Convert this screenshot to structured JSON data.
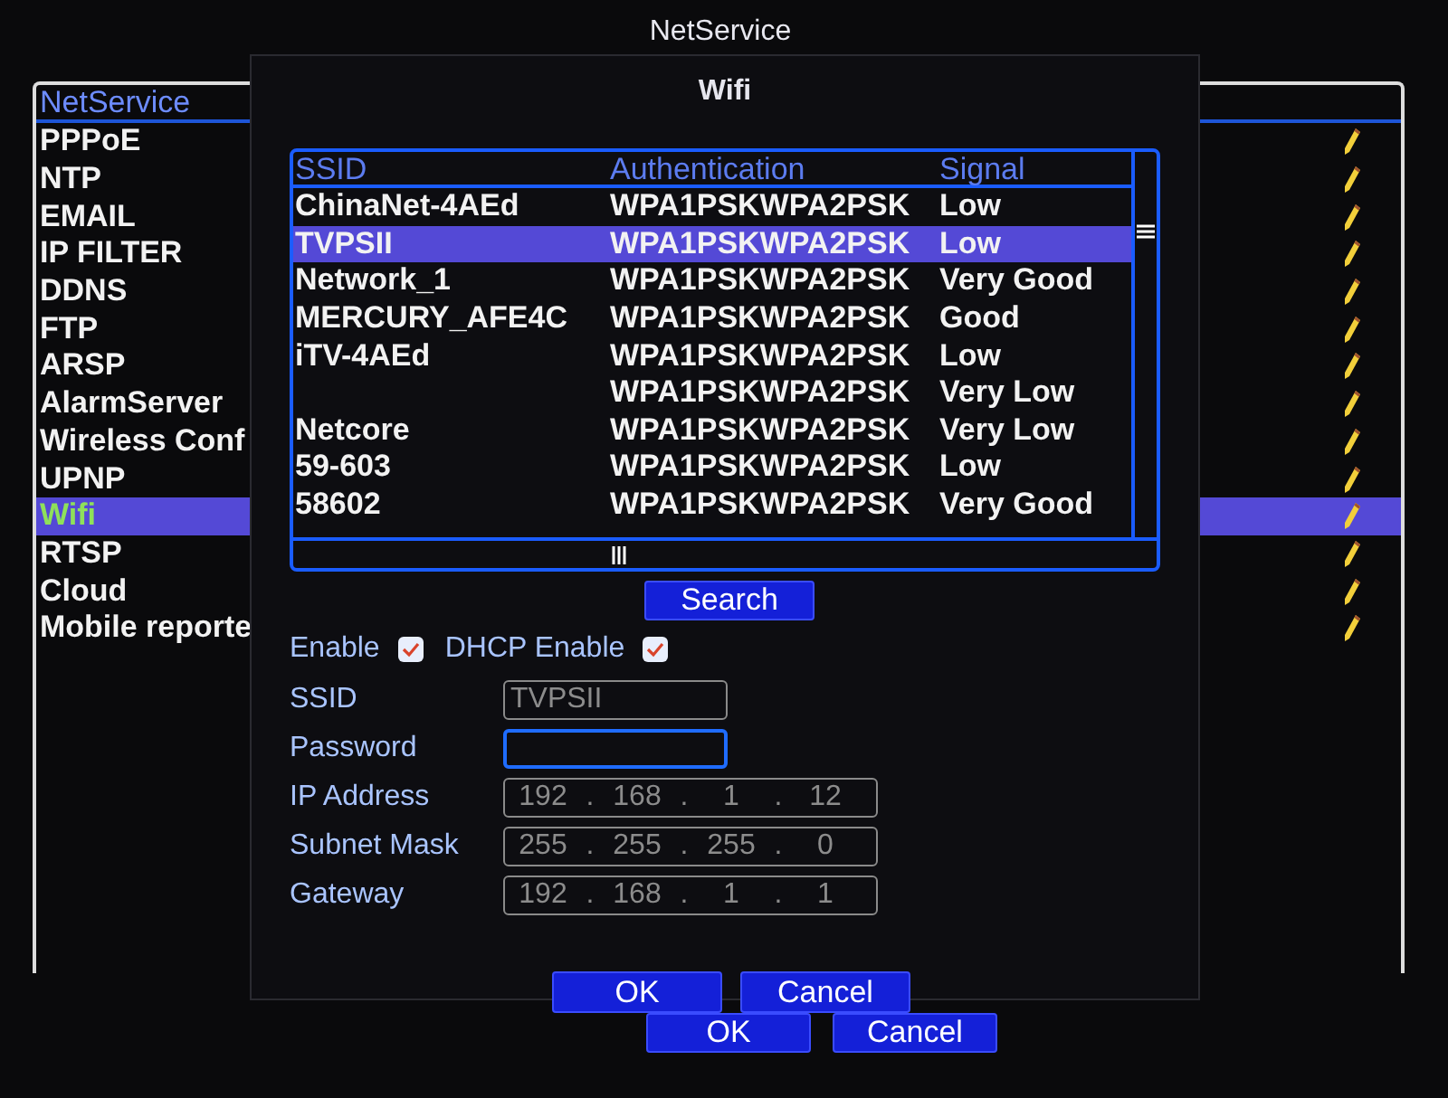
{
  "window": {
    "title": "NetService"
  },
  "service_list": {
    "header": "NetService",
    "items": [
      {
        "label": "PPPoE",
        "selected": false
      },
      {
        "label": "NTP",
        "selected": false
      },
      {
        "label": "EMAIL",
        "selected": false
      },
      {
        "label": "IP FILTER",
        "selected": false
      },
      {
        "label": "DDNS",
        "selected": false
      },
      {
        "label": "FTP",
        "selected": false
      },
      {
        "label": "ARSP",
        "selected": false
      },
      {
        "label": "AlarmServer",
        "selected": false
      },
      {
        "label": "Wireless Conf",
        "selected": false
      },
      {
        "label": "UPNP",
        "selected": false
      },
      {
        "label": "Wifi",
        "selected": true
      },
      {
        "label": "RTSP",
        "selected": false
      },
      {
        "label": "Cloud",
        "selected": false
      },
      {
        "label": "Mobile reporte",
        "selected": false
      }
    ]
  },
  "buttons": [
    "OK",
    "Cancel"
  ],
  "dialog": {
    "title": "Wifi",
    "table": {
      "columns": [
        "SSID",
        "Authentication",
        "Signal"
      ],
      "rows": [
        {
          "ssid": "ChinaNet-4AEd",
          "auth": "WPA1PSKWPA2PSK",
          "signal": "Low",
          "selected": false
        },
        {
          "ssid": "TVPSII",
          "auth": "WPA1PSKWPA2PSK",
          "signal": "Low",
          "selected": true
        },
        {
          "ssid": "Network_1",
          "auth": "WPA1PSKWPA2PSK",
          "signal": "Very Good",
          "selected": false
        },
        {
          "ssid": "MERCURY_AFE4C",
          "auth": "WPA1PSKWPA2PSK",
          "signal": "Good",
          "selected": false
        },
        {
          "ssid": "iTV-4AEd",
          "auth": "WPA1PSKWPA2PSK",
          "signal": "Low",
          "selected": false
        },
        {
          "auth": "WPA1PSKWPA2PSK",
          "signal": "Very Low",
          "selected": false
        },
        {
          "ssid": "Netcore",
          "auth": "WPA1PSKWPA2PSK",
          "signal": "Very Low",
          "selected": false
        },
        {
          "ssid": "59-603",
          "auth": "WPA1PSKWPA2PSK",
          "signal": "Low",
          "selected": false
        },
        {
          "ssid": "58602",
          "auth": "WPA1PSKWPA2PSK",
          "signal": "Very Good",
          "selected": false
        }
      ]
    },
    "search_button": "Search",
    "enable": {
      "label": "Enable",
      "checked": true
    },
    "dhcp": {
      "label": "DHCP Enable",
      "checked": true
    },
    "fields": [
      {
        "kind": "text",
        "label": "SSID",
        "value": "TVPSII",
        "focused": false
      },
      {
        "kind": "text",
        "label": "Password",
        "focused": true
      },
      {
        "kind": "ip",
        "label": "IP Address",
        "octets": [
          "192",
          "168",
          "1",
          "12"
        ],
        "separator": "."
      },
      {
        "kind": "ip",
        "label": "Subnet Mask",
        "octets": [
          "255",
          "255",
          "255",
          "0"
        ],
        "separator": "."
      },
      {
        "kind": "ip",
        "label": "Gateway",
        "octets": [
          "192",
          "168",
          "1",
          "1"
        ],
        "separator": "."
      }
    ],
    "buttons": [
      "OK",
      "Cancel"
    ]
  }
}
